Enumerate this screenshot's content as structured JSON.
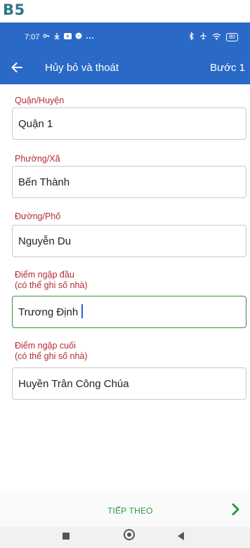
{
  "step_label": "B5",
  "status_bar": {
    "time": "7:07",
    "left_icons": [
      "vpn-key-icon",
      "download-icon",
      "youtube-icon",
      "messenger-icon",
      "more-icon"
    ],
    "right_icons": [
      "bluetooth-icon",
      "airplane-icon",
      "wifi-icon"
    ],
    "battery": "80"
  },
  "app_bar": {
    "title": "Hủy bỏ và thoát",
    "step": "Bước 1"
  },
  "form": {
    "district": {
      "label": "Quận/Huyện",
      "value": "Quận 1"
    },
    "ward": {
      "label": "Phường/Xã",
      "value": "Bến Thành"
    },
    "street": {
      "label": "Đường/Phố",
      "value": "Nguyễn Du"
    },
    "start_point": {
      "label_line1": "Điểm ngập đầu",
      "label_line2": "(có thể ghi số nhà)",
      "value": "Trương Định"
    },
    "end_point": {
      "label_line1": "Điểm ngập cuối",
      "label_line2": "(có thể ghi số nhà)",
      "value": "Huyền Trân Công Chúa"
    }
  },
  "bottom": {
    "next_label": "TIẾP THEO"
  },
  "colors": {
    "primary": "#2a69c6",
    "label_red": "#b62a35",
    "next_green": "#2a9a3a",
    "focus_green": "#3b8d3f"
  }
}
